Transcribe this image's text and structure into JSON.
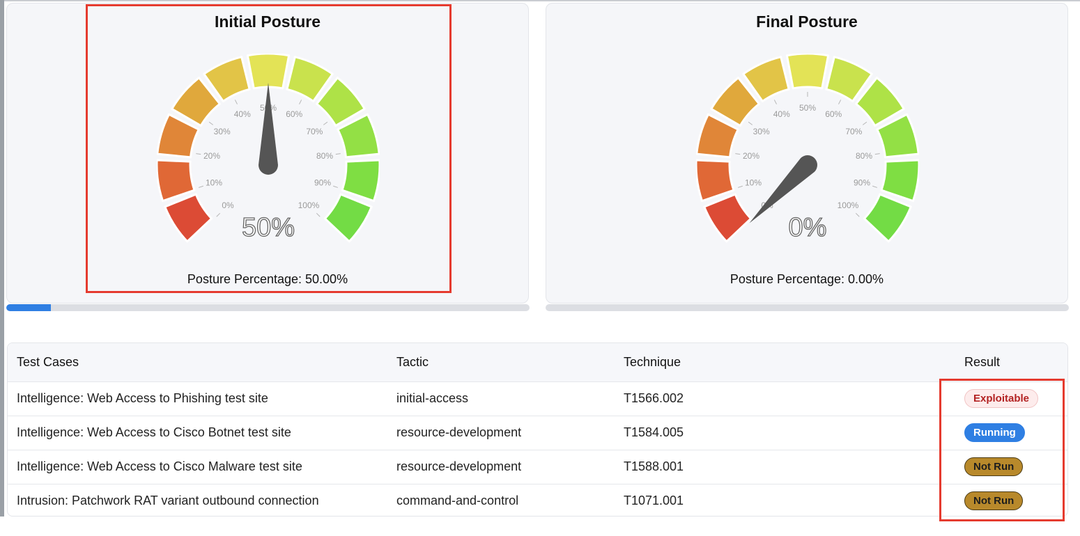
{
  "gauges": [
    {
      "id": "initial",
      "title": "Initial Posture",
      "value_label": "50%",
      "value": 50,
      "posture_text": "Posture Percentage: 50.00%",
      "progress": 0.085
    },
    {
      "id": "final",
      "title": "Final Posture",
      "value_label": "0%",
      "value": 0,
      "posture_text": "Posture Percentage: 0.00%",
      "progress": 0
    }
  ],
  "tick_labels": [
    "0%",
    "10%",
    "20%",
    "30%",
    "40%",
    "50%",
    "60%",
    "70%",
    "80%",
    "90%",
    "100%"
  ],
  "segment_colors": [
    "#dc4b35",
    "#e06836",
    "#e08638",
    "#e0a83c",
    "#e2c447",
    "#e3e356",
    "#c9e24d",
    "#aee247",
    "#93e045",
    "#7fde43",
    "#73dc45"
  ],
  "table": {
    "headers": {
      "test": "Test Cases",
      "tactic": "Tactic",
      "technique": "Technique",
      "result": "Result"
    },
    "rows": [
      {
        "test": "Intelligence: Web Access to Phishing test site",
        "tactic": "initial-access",
        "technique": "T1566.002",
        "result": "Exploitable",
        "status": "exploitable"
      },
      {
        "test": "Intelligence: Web Access to Cisco Botnet test site",
        "tactic": "resource-development",
        "technique": "T1584.005",
        "result": "Running",
        "status": "running"
      },
      {
        "test": "Intelligence: Web Access to Cisco Malware test site",
        "tactic": "resource-development",
        "technique": "T1588.001",
        "result": "Not Run",
        "status": "notrun"
      },
      {
        "test": "Intrusion: Patchwork RAT variant outbound connection",
        "tactic": "command-and-control",
        "technique": "T1071.001",
        "result": "Not Run",
        "status": "notrun"
      }
    ]
  },
  "colors": {
    "accent": "#2f7fe3",
    "highlight": "#e53b2f",
    "needle": "#555555"
  }
}
